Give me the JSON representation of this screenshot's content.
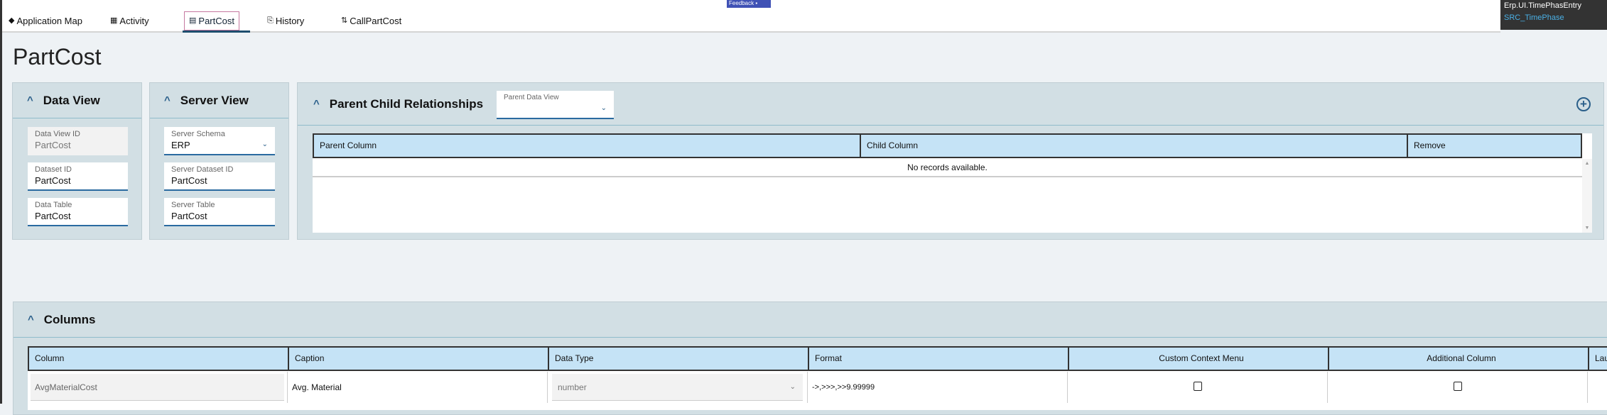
{
  "tabs": [
    {
      "label": "Application Map",
      "icon": "layers-icon"
    },
    {
      "label": "Activity",
      "icon": "table-icon"
    },
    {
      "label": "PartCost",
      "icon": "document-icon",
      "active": true
    },
    {
      "label": "History",
      "icon": "history-icon"
    },
    {
      "label": "CallPartCost",
      "icon": "flow-icon"
    }
  ],
  "feedback": "Feedback",
  "context": {
    "line1": "Erp.UI.TimePhasEntry",
    "line2": "SRC_TimePhase"
  },
  "page_title": "PartCost",
  "data_view": {
    "title": "Data View",
    "fields": [
      {
        "label": "Data View ID",
        "value": "PartCost"
      },
      {
        "label": "Dataset ID",
        "value": "PartCost"
      },
      {
        "label": "Data Table",
        "value": "PartCost"
      }
    ]
  },
  "server_view": {
    "title": "Server View",
    "fields": [
      {
        "label": "Server Schema",
        "value": "ERP"
      },
      {
        "label": "Server Dataset ID",
        "value": "PartCost"
      },
      {
        "label": "Server Table",
        "value": "PartCost"
      }
    ]
  },
  "relationships": {
    "title": "Parent Child Relationships",
    "parent_data_view_label": "Parent Data View",
    "parent_data_view_value": "",
    "columns": [
      "Parent Column",
      "Child Column",
      "Remove"
    ],
    "empty": "No records available."
  },
  "columns": {
    "title": "Columns",
    "headers": [
      "Column",
      "Caption",
      "Data Type",
      "Format",
      "Custom Context Menu",
      "Additional Column",
      "Lau"
    ],
    "rows": [
      {
        "column": "AvgMaterialCost",
        "caption": "Avg. Material",
        "data_type": "number",
        "format": "->,>>>,>>9.99999",
        "custom_context_menu": false,
        "additional_column": false
      }
    ]
  },
  "colors": {
    "accent": "#2a6aa0",
    "header_bg": "#c5e3f6",
    "panel_bg": "#d2dfe4",
    "feedback": "#3f51b5"
  }
}
